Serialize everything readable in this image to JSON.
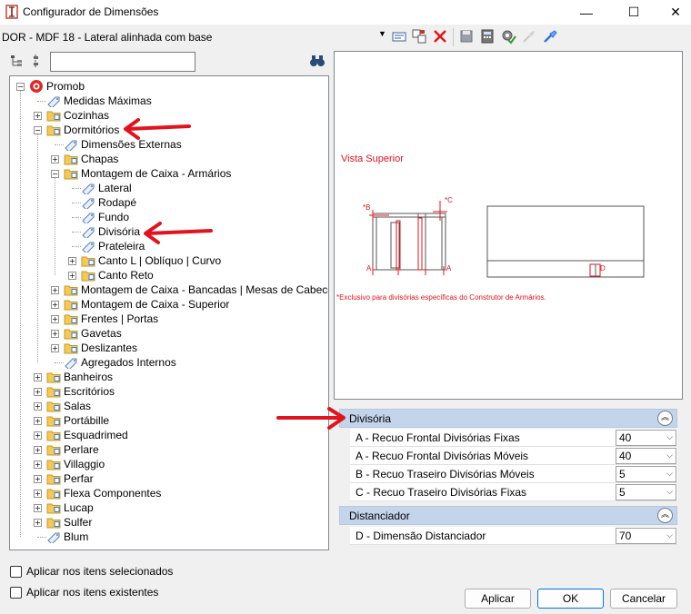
{
  "window": {
    "title": "Configurador de Dimensões",
    "controls": {
      "minimize": "—",
      "maximize": "☐",
      "close": "✕"
    }
  },
  "toolbar": {
    "profile_value": "DOR - MDF 18 - Lateral alinhada com base",
    "search_value": ""
  },
  "tree": {
    "items": [
      {
        "label": "Promob"
      },
      {
        "label": "Medidas Máximas"
      },
      {
        "label": "Cozinhas"
      },
      {
        "label": "Dormitórios"
      },
      {
        "label": "Dimensões Externas"
      },
      {
        "label": "Chapas"
      },
      {
        "label": "Montagem de Caixa - Armários"
      },
      {
        "label": "Lateral"
      },
      {
        "label": "Rodapé"
      },
      {
        "label": "Fundo"
      },
      {
        "label": "Divisória"
      },
      {
        "label": "Prateleira"
      },
      {
        "label": "Canto L | Oblíquo | Curvo"
      },
      {
        "label": "Canto Reto"
      },
      {
        "label": "Montagem de Caixa - Bancadas | Mesas de Cabeceira"
      },
      {
        "label": "Montagem de Caixa - Superior"
      },
      {
        "label": "Frentes | Portas"
      },
      {
        "label": "Gavetas"
      },
      {
        "label": "Deslizantes"
      },
      {
        "label": "Agregados Internos"
      },
      {
        "label": "Banheiros"
      },
      {
        "label": "Escritórios"
      },
      {
        "label": "Salas"
      },
      {
        "label": "Portábille"
      },
      {
        "label": "Esquadrimed"
      },
      {
        "label": "Perlare"
      },
      {
        "label": "Villaggio"
      },
      {
        "label": "Perfar"
      },
      {
        "label": "Flexa Componentes"
      },
      {
        "label": "Lucap"
      },
      {
        "label": "Sulfer"
      },
      {
        "label": "Blum"
      }
    ]
  },
  "options": {
    "apply_selected": "Aplicar nos itens selecionados",
    "apply_existing": "Aplicar nos itens existentes"
  },
  "preview": {
    "view_label": "Vista Superior",
    "note": "*Exclusivo para divisórias específicas do Construtor de Armários.",
    "markers": {
      "a": "A",
      "b": "*B",
      "c": "*C",
      "d": "D"
    }
  },
  "groups": [
    {
      "title": "Divisória",
      "props": [
        {
          "label": "A - Recuo Frontal Divisórias Fixas",
          "value": "40"
        },
        {
          "label": "A - Recuo Frontal Divisórias Móveis",
          "value": "40"
        },
        {
          "label": "B - Recuo Traseiro Divisórias Móveis",
          "value": "5"
        },
        {
          "label": "C - Recuo Traseiro Divisórias Fixas",
          "value": "5"
        }
      ]
    },
    {
      "title": "Distanciador",
      "props": [
        {
          "label": "D - Dimensão Distanciador",
          "value": "70"
        }
      ]
    }
  ],
  "buttons": {
    "apply": "Aplicar",
    "ok": "OK",
    "cancel": "Cancelar"
  },
  "colors": {
    "accent_red": "#e0141e",
    "group_header": "#c4d4ea",
    "folder_yellow": "#f3c957"
  }
}
